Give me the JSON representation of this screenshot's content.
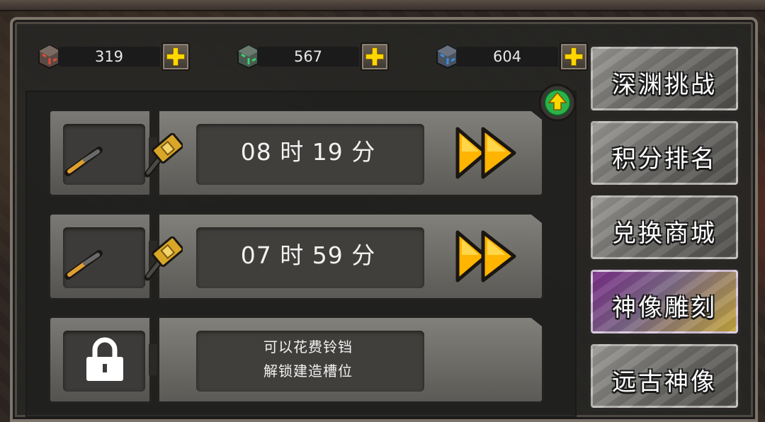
{
  "currencies": [
    {
      "icon": "red-cube-icon",
      "color": "#e04a3a",
      "value": "319",
      "plus_label": "add-button"
    },
    {
      "icon": "green-cube-icon",
      "color": "#3ad06a",
      "value": "567",
      "plus_label": "add-button"
    },
    {
      "icon": "blue-cube-icon",
      "color": "#3a8ee0",
      "value": "604",
      "plus_label": "add-button"
    }
  ],
  "slots": [
    {
      "time": "08 时 19 分",
      "state": "building"
    },
    {
      "time": "07 时 59 分",
      "state": "building"
    },
    {
      "state": "locked",
      "line1": "可以花费铃铛",
      "line2": "解锁建造槽位"
    }
  ],
  "menu": [
    {
      "label": "深渊挑战",
      "active": false
    },
    {
      "label": "积分排名",
      "active": false
    },
    {
      "label": "兑换商城",
      "active": false
    },
    {
      "label": "神像雕刻",
      "active": true
    },
    {
      "label": "远古神像",
      "active": false
    }
  ],
  "colors": {
    "accent_yellow": "#ffd600",
    "speed_arrow": "#ffb400",
    "upgrade_green": "#2bb24c"
  }
}
